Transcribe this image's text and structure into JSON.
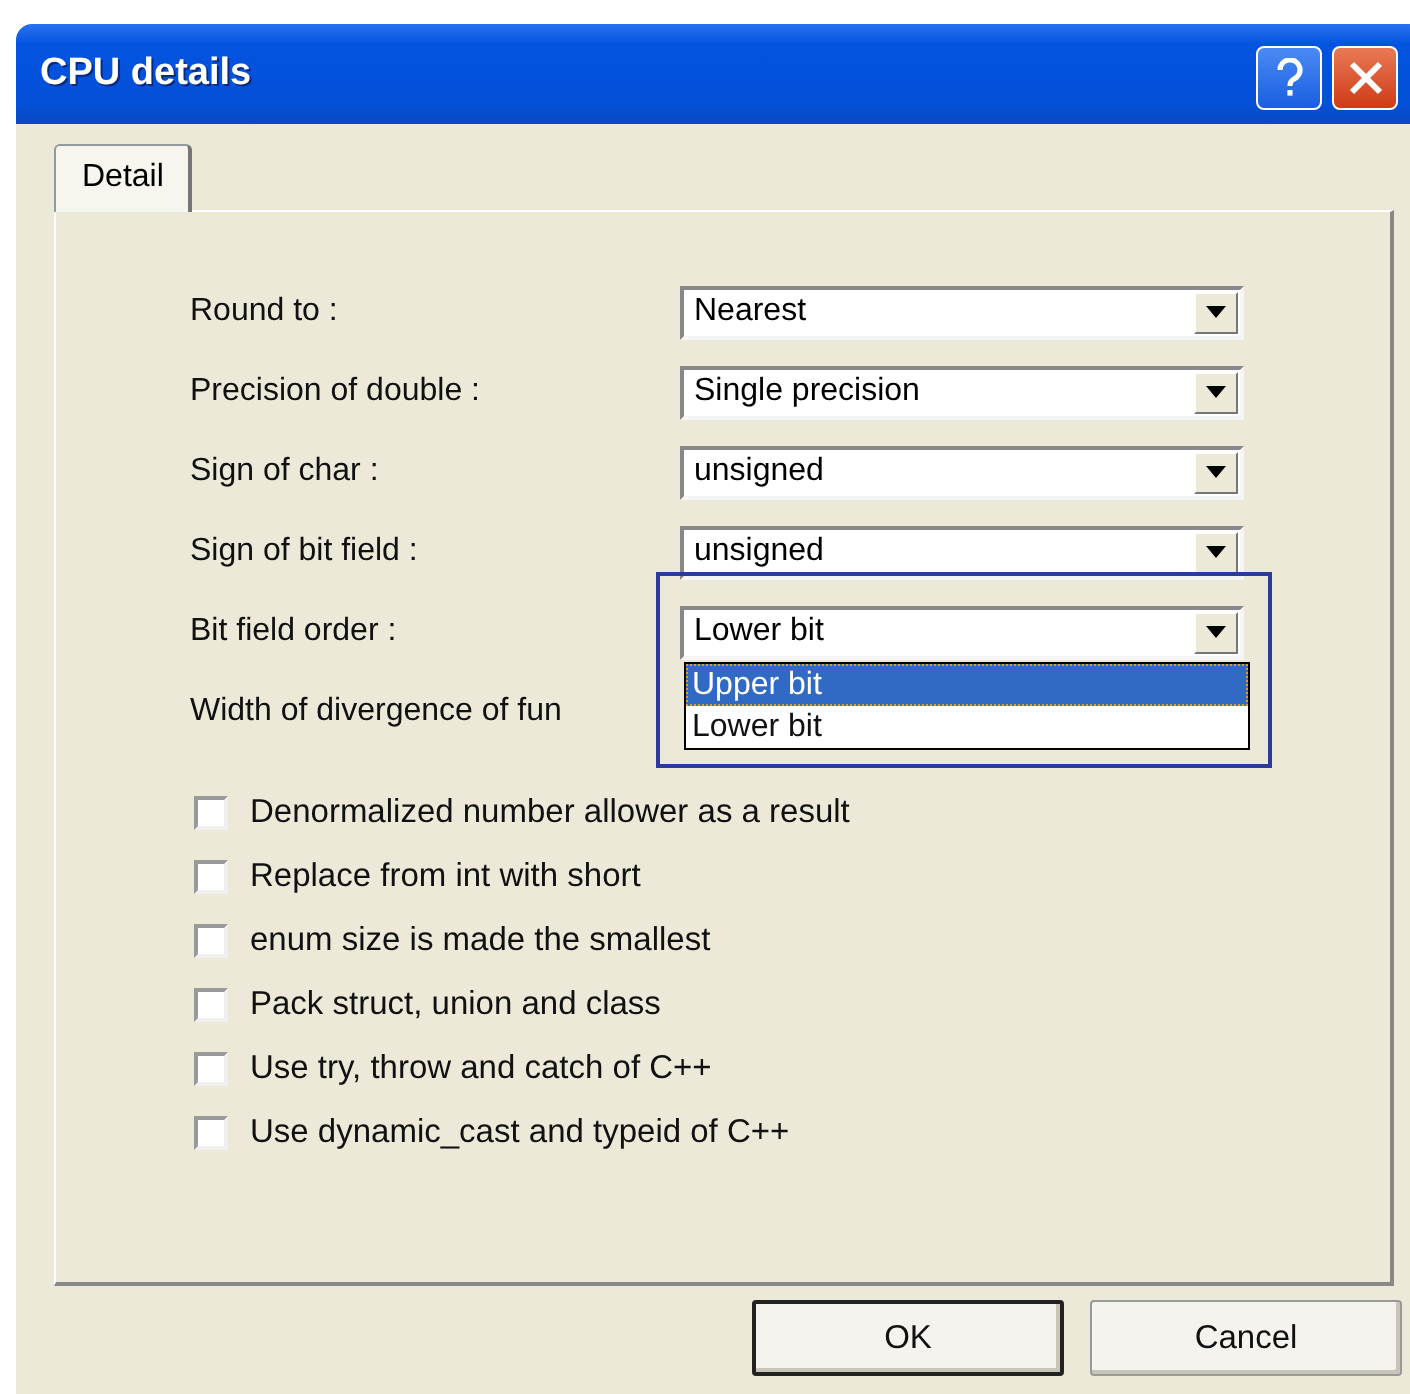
{
  "window": {
    "title": "CPU details"
  },
  "tabs": [
    {
      "label": "Detail",
      "selected": true
    }
  ],
  "fields": [
    {
      "kind": "combo",
      "label": "Round to :",
      "value": "Nearest",
      "expanded": false
    },
    {
      "kind": "combo",
      "label": "Precision of double :",
      "value": "Single precision",
      "expanded": false
    },
    {
      "kind": "combo",
      "label": "Sign of char :",
      "value": "unsigned",
      "expanded": false
    },
    {
      "kind": "combo",
      "label": "Sign of bit field :",
      "value": "unsigned",
      "expanded": false
    },
    {
      "kind": "combo",
      "label": "Bit field order :",
      "value": "Lower bit",
      "expanded": true,
      "options": [
        {
          "label": "Upper bit",
          "highlighted": true
        },
        {
          "label": "Lower bit",
          "highlighted": false
        }
      ]
    },
    {
      "kind": "label",
      "label": "Width of divergence of fun"
    }
  ],
  "checkboxes": [
    {
      "label": "Denormalized number allower as a result",
      "checked": false
    },
    {
      "label": "Replace from int with short",
      "checked": false
    },
    {
      "label": "enum size is made the smallest",
      "checked": false
    },
    {
      "label": "Pack struct, union and class",
      "checked": false
    },
    {
      "label": "Use try, throw and catch of C++",
      "checked": false
    },
    {
      "label": "Use dynamic_cast and typeid of C++",
      "checked": false
    }
  ],
  "buttons": [
    {
      "label": "OK",
      "default": true
    },
    {
      "label": "Cancel",
      "default": false
    }
  ]
}
